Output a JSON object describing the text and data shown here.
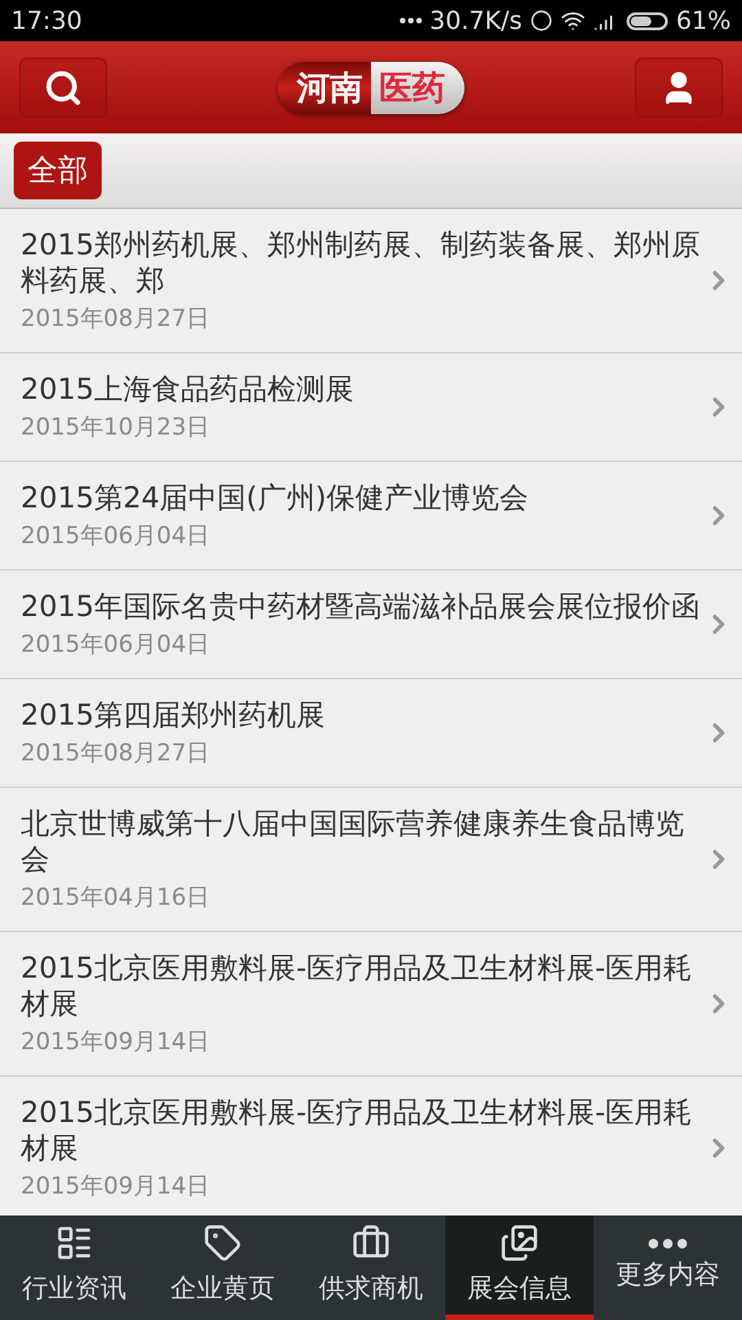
{
  "status_bar": {
    "time": "17:30",
    "speed": "30.7K/s",
    "battery": "61%"
  },
  "header": {
    "logo": [
      "河南",
      "医药"
    ]
  },
  "filter": {
    "label": "全部",
    "selected": true
  },
  "items": [
    {
      "title": "2015郑州药机展、郑州制药展、制药装备展、郑州原料药展、郑",
      "date": "2015年08月27日"
    },
    {
      "title": "2015上海食品药品检测展",
      "date": "2015年10月23日"
    },
    {
      "title": "2015第24届中国(广州)保健产业博览会",
      "date": "2015年06月04日"
    },
    {
      "title": "2015年国际名贵中药材暨高端滋补品展会展位报价函",
      "date": "2015年06月04日"
    },
    {
      "title": "2015第四届郑州药机展",
      "date": "2015年08月27日"
    },
    {
      "title": "北京世博威第十八届中国国际营养健康养生食品博览会",
      "date": "2015年04月16日"
    },
    {
      "title": "2015北京医用敷料展-医疗用品及卫生材料展-医用耗材展",
      "date": "2015年09月14日"
    },
    {
      "title": "2015北京医用敷料展-医疗用品及卫生材料展-医用耗材展",
      "date": "2015年09月14日"
    }
  ],
  "tabs": [
    {
      "label": "行业资讯",
      "selected": false
    },
    {
      "label": "企业黄页",
      "selected": false
    },
    {
      "label": "供求商机",
      "selected": false
    },
    {
      "label": "展会信息",
      "selected": true
    },
    {
      "label": "更多内容",
      "selected": false
    }
  ]
}
